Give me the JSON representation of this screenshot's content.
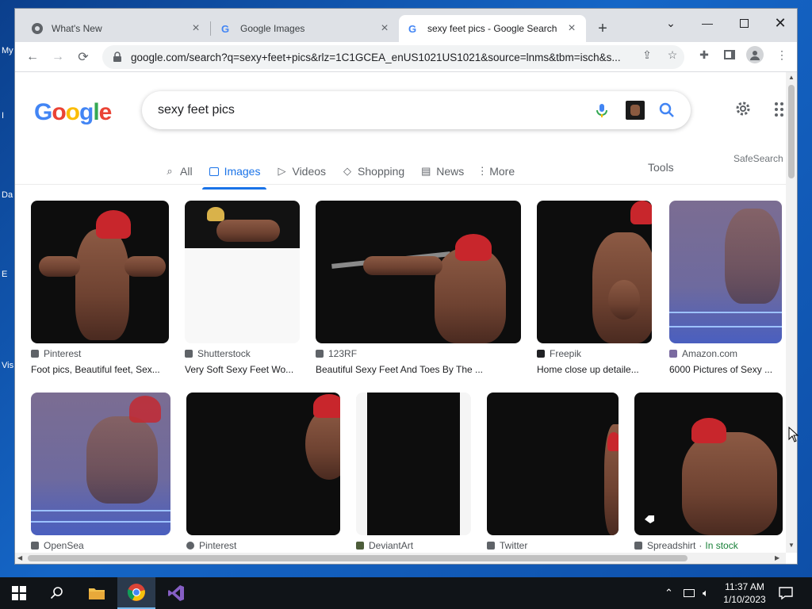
{
  "tabs": [
    {
      "title": "What's New"
    },
    {
      "title": "Google Images"
    },
    {
      "title": "sexy feet pics - Google Search"
    }
  ],
  "url": "google.com/search?q=sexy+feet+pics&rlz=1C1GCEA_enUS1021US1021&source=lnms&tbm=isch&s...",
  "search": {
    "query": "sexy feet pics"
  },
  "nav": {
    "all": "All",
    "images": "Images",
    "videos": "Videos",
    "shopping": "Shopping",
    "news": "News",
    "more": "More",
    "tools": "Tools",
    "safesearch": "SafeSearch"
  },
  "results": [
    {
      "source": "Pinterest",
      "caption": "Foot pics, Beautiful feet, Sex..."
    },
    {
      "source": "Shutterstock",
      "caption": "Very Soft Sexy Feet Wo..."
    },
    {
      "source": "123RF",
      "caption": "Beautiful Sexy Feet And Toes By The ..."
    },
    {
      "source": "Freepik",
      "caption": "Home close up detaile..."
    },
    {
      "source": "Amazon.com",
      "caption": "6000 Pictures of Sexy ..."
    },
    {
      "source": "OpenSea",
      "caption": ""
    },
    {
      "source": "Pinterest",
      "caption": ""
    },
    {
      "source": "DeviantArt",
      "caption": ""
    },
    {
      "source": "Twitter",
      "caption": ""
    },
    {
      "source": "Spreadshirt",
      "stock": "In stock",
      "caption": ""
    }
  ],
  "taskbar": {
    "time": "11:37 AM",
    "date": "1/10/2023"
  },
  "colors": {
    "google_blue": "#4285f4",
    "google_red": "#ea4335",
    "google_yellow": "#fbbc05",
    "google_green": "#34a853",
    "link_blue": "#1a73e8"
  }
}
